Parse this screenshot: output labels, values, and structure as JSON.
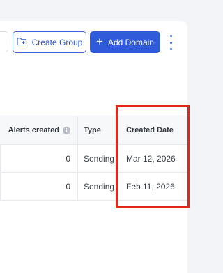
{
  "toolbar": {
    "create_group_label": "Create Group",
    "add_domain_label": "Add Domain",
    "plus_glyph": "+"
  },
  "table": {
    "headers": {
      "alerts": "Alerts created",
      "info": "i",
      "type": "Type",
      "created_date": "Created Date"
    },
    "rows": [
      {
        "alerts": "0",
        "type": "Sending",
        "created_date": "Mar 12, 2026"
      },
      {
        "alerts": "0",
        "type": "Sending",
        "created_date": "Feb 11, 2026"
      }
    ]
  },
  "colors": {
    "primary": "#2f5bda",
    "highlight": "#e2261c"
  },
  "icons": {
    "create_group": "folder-plus-icon",
    "info": "info-icon",
    "more": "kebab-menu-icon"
  }
}
